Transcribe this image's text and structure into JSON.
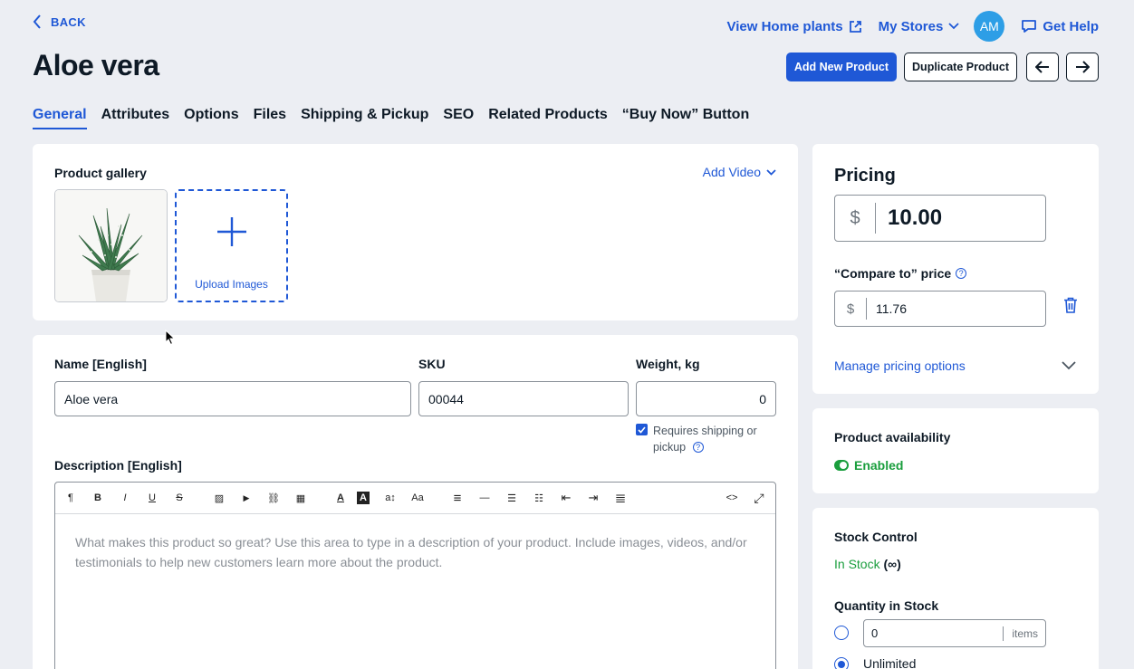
{
  "nav": {
    "back_label": "BACK",
    "view_home_label": "View Home plants",
    "my_stores_label": "My Stores",
    "avatar_initials": "AM",
    "help_label": "Get Help"
  },
  "page": {
    "title": "Aloe vera"
  },
  "header_actions": {
    "add_new_label": "Add New Product",
    "duplicate_label": "Duplicate Product"
  },
  "tabs": [
    {
      "label": "General",
      "active": true
    },
    {
      "label": "Attributes"
    },
    {
      "label": "Options"
    },
    {
      "label": "Files"
    },
    {
      "label": "Shipping & Pickup"
    },
    {
      "label": "SEO"
    },
    {
      "label": "Related Products"
    },
    {
      "label": "“Buy Now” Button"
    }
  ],
  "gallery": {
    "title": "Product gallery",
    "add_video_label": "Add Video",
    "upload_label": "Upload Images"
  },
  "details": {
    "name_label": "Name [English]",
    "name_value": "Aloe vera",
    "sku_label": "SKU",
    "sku_value": "00044",
    "weight_label": "Weight, kg",
    "weight_value": "0",
    "requires_shipping_label": "Requires shipping or pickup",
    "requires_shipping_checked": true,
    "description_label": "Description [English]",
    "description_placeholder": "What makes this product so great? Use this area to type in a description of your product. Include images, videos, and/or testimonials to help new customers learn more about the product."
  },
  "editor_toolbar": [
    {
      "icon": "paragraph-icon",
      "glyph": "¶"
    },
    {
      "icon": "bold-icon",
      "glyph": "B"
    },
    {
      "icon": "italic-icon",
      "glyph": "I"
    },
    {
      "icon": "underline-icon",
      "glyph": "U"
    },
    {
      "icon": "strikethrough-icon",
      "glyph": "S"
    },
    {
      "icon": "image-icon",
      "glyph": "▨"
    },
    {
      "icon": "video-icon",
      "glyph": "▶"
    },
    {
      "icon": "link-icon",
      "glyph": "⛓"
    },
    {
      "icon": "table-icon",
      "glyph": "▦"
    },
    {
      "icon": "text-color-icon",
      "glyph": "A"
    },
    {
      "icon": "background-color-icon",
      "glyph": "A"
    },
    {
      "icon": "font-size-icon",
      "glyph": "a↕"
    },
    {
      "icon": "font-family-icon",
      "glyph": "Aa"
    },
    {
      "icon": "align-icon",
      "glyph": "≡"
    },
    {
      "icon": "horizontal-line-icon",
      "glyph": "—"
    },
    {
      "icon": "bullet-list-icon",
      "glyph": "☰"
    },
    {
      "icon": "numbered-list-icon",
      "glyph": "☷"
    },
    {
      "icon": "outdent-icon",
      "glyph": "⇤"
    },
    {
      "icon": "indent-icon",
      "glyph": "⇥"
    },
    {
      "icon": "paragraph-format-icon",
      "glyph": "≣"
    },
    {
      "icon": "code-view-icon",
      "glyph": "<>"
    },
    {
      "icon": "fullscreen-icon",
      "glyph": "⤢"
    }
  ],
  "pricing": {
    "title": "Pricing",
    "currency": "$",
    "price_value": "10.00",
    "compare_label": "“Compare to” price",
    "compare_value": "11.76",
    "manage_label": "Manage pricing options"
  },
  "availability": {
    "title": "Product availability",
    "status": "Enabled"
  },
  "stock": {
    "title": "Stock Control",
    "status": "In Stock",
    "status_suffix": "(∞)",
    "quantity_label": "Quantity in Stock",
    "quantity_value": "0",
    "quantity_unit": "items",
    "unlimited_label": "Unlimited"
  },
  "colors": {
    "accent": "#1f58d6",
    "success": "#1a9e3d",
    "avatar_bg": "#2d9ee6"
  }
}
